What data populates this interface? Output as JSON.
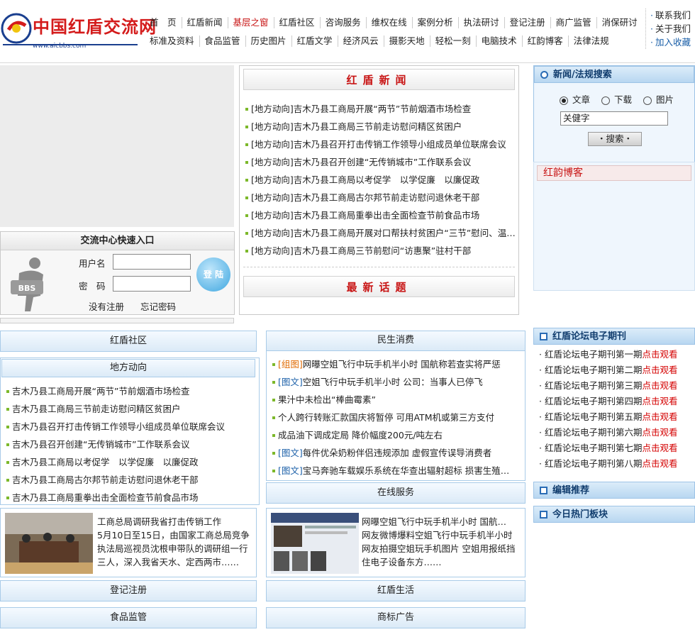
{
  "logo": {
    "cn": "中国红盾交流网",
    "url": "www.aicbbs.com"
  },
  "nav": {
    "row1": [
      "首　页",
      "红盾新闻",
      "基层之窗",
      "红盾社区",
      "咨询服务",
      "维权在线",
      "案例分析",
      "执法研讨",
      "登记注册",
      "商广监管",
      "消保研讨"
    ],
    "row2": [
      "标准及资料",
      "食品监管",
      "历史图片",
      "红盾文学",
      "经济风云",
      "摄影天地",
      "轻松一刻",
      "电脑技术",
      "红韵博客",
      "法律法规"
    ],
    "active": "基层之窗"
  },
  "toplinks": [
    "联系我们",
    "关于我们",
    "加入收藏"
  ],
  "login": {
    "title": "交流中心快速入口",
    "user_label": "用户名",
    "pass_label": "密　码",
    "login_btn": "登 陆",
    "register": "没有注册",
    "forgot": "忘记密码",
    "bbs": "BBS"
  },
  "news": {
    "title": "红盾新闻",
    "items": [
      "[地方动向]吉木乃县工商局开展“两节”节前烟酒市场检查",
      "[地方动向]吉木乃县工商局三节前走访慰问精区贫困户",
      "[地方动向]吉木乃县召开打击传销工作领导小组成员单位联席会议",
      "[地方动向]吉木乃县召开创建“无传销城市”工作联系会议",
      "[地方动向]吉木乃县工商局以考促学　以学促廉　以廉促政",
      "[地方动向]吉木乃县工商局古尔邦节前走访慰问退休老干部",
      "[地方动向]吉木乃县工商局重拳出击全面检查节前食品市场",
      "[地方动向]吉木乃县工商局开展对口帮扶村贫困户“三节”慰问、温…",
      "[地方动向]吉木乃县工商局三节前慰问“访惠聚”驻村干部"
    ],
    "latest": "最新话题"
  },
  "search": {
    "title": "新闻/法规搜索",
    "options": [
      "文章",
      "下载",
      "图片"
    ],
    "selected": "文章",
    "keyword": "关健字",
    "btn": "・搜索・"
  },
  "blog": {
    "title": "红韵博客"
  },
  "community": {
    "title": "红盾社区"
  },
  "local": {
    "title": "地方动向",
    "items": [
      "吉木乃县工商局开展“两节”节前烟酒市场检查",
      "吉木乃县工商局三节前走访慰问精区贫困户",
      "吉木乃县召开打击传销工作领导小组成员单位联席会议",
      "吉木乃县召开创建“无传销城市”工作联系会议",
      "吉木乃县工商局以考促学　以学促廉　以廉促政",
      "吉木乃县工商局古尔邦节前走访慰问退休老干部",
      "吉木乃县工商局重拳出击全面检查节前食品市场"
    ]
  },
  "feature1": {
    "title": "工商总局调研我省打击传销工作",
    "body": "5月10日至15日，由国家工商总局竞争执法局巡视员沈根申带队的调研组一行三人，深入我省天水、定西两市……"
  },
  "livelihood": {
    "title": "民生消费",
    "items": [
      {
        "tag": "[组图]",
        "text": "网曝空姐飞行中玩手机半小时 国航称若查实将严惩",
        "tagcolor": "o"
      },
      {
        "tag": "[图文]",
        "text": "空姐飞行中玩手机半小时 公司：当事人已停飞",
        "tagcolor": "b"
      },
      {
        "tag": "",
        "text": "果汁中未检出“棒曲霉素”",
        "tagcolor": ""
      },
      {
        "tag": "",
        "text": "个人跨行转账汇款国庆将暂停 可用ATM机或第三方支付",
        "tagcolor": ""
      },
      {
        "tag": "",
        "text": "成品油下调成定局 降价幅度200元/吨左右",
        "tagcolor": ""
      },
      {
        "tag": "[图文]",
        "text": "每件优朵奶粉伴侣违规添加 虚假宣传误导消费者",
        "tagcolor": "b"
      },
      {
        "tag": "[图文]",
        "text": "宝马奔驰车载娱乐系统在华查出辐射超标 损害生殖…",
        "tagcolor": "b"
      }
    ]
  },
  "online": {
    "title": "在线服务"
  },
  "feature2": {
    "title": "网曝空姐飞行中玩手机半小时 国航…",
    "body": "网友微博爆料空姐飞行中玩手机半小时 网友拍摄空姐玩手机图片 空姐用报纸挡住电子设备东方……"
  },
  "bottom": {
    "reg": "登记注册",
    "life": "红盾生活",
    "food": "食品监管",
    "ad": "商标广告"
  },
  "ejournal": {
    "title": "红盾论坛电子期刊",
    "items": [
      "红盾论坛电子期刊第一期",
      "红盾论坛电子期刊第二期",
      "红盾论坛电子期刊第三期",
      "红盾论坛电子期刊第四期",
      "红盾论坛电子期刊第五期",
      "红盾论坛电子期刊第六期",
      "红盾论坛电子期刊第七期",
      "红盾论坛电子期刊第八期"
    ],
    "link": "点击观看"
  },
  "recommend": {
    "title": "编辑推荐"
  },
  "hot": {
    "title": "今日热门板块"
  }
}
